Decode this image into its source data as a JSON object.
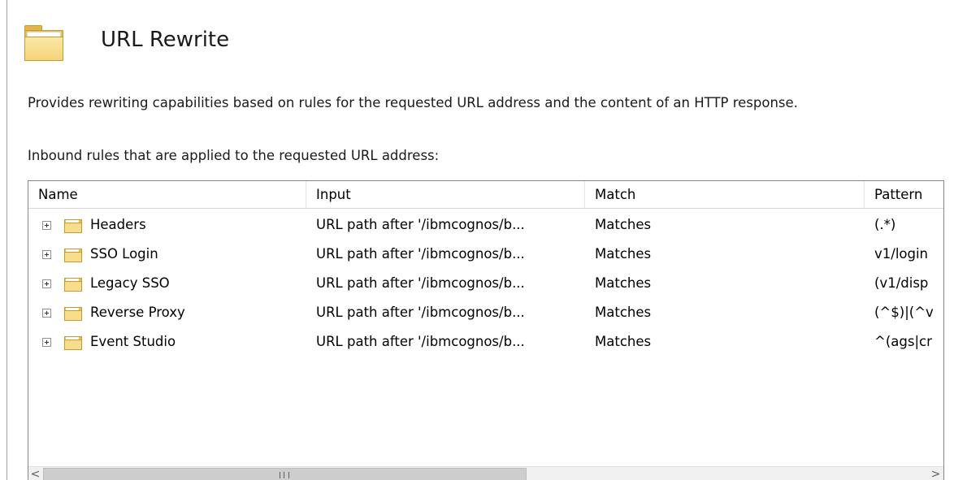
{
  "header": {
    "title": "URL Rewrite",
    "icon": "folder-icon"
  },
  "description": "Provides rewriting capabilities based on rules for the requested URL address and the content of an HTTP response.",
  "inbound": {
    "heading": "Inbound rules that are applied to the requested URL address:",
    "columns": [
      "Name",
      "Input",
      "Match",
      "Pattern"
    ],
    "rows": [
      {
        "name": "Headers",
        "input": "URL path after '/ibmcognos/b...",
        "match": "Matches",
        "pattern": "(.*)"
      },
      {
        "name": "SSO Login",
        "input": "URL path after '/ibmcognos/b...",
        "match": "Matches",
        "pattern": "v1/login"
      },
      {
        "name": "Legacy SSO",
        "input": "URL path after '/ibmcognos/b...",
        "match": "Matches",
        "pattern": "(v1/disp"
      },
      {
        "name": "Reverse Proxy",
        "input": "URL path after '/ibmcognos/b...",
        "match": "Matches",
        "pattern": "(^$)|(^v"
      },
      {
        "name": "Event Studio",
        "input": "URL path after '/ibmcognos/b...",
        "match": "Matches",
        "pattern": "^(ags|cr"
      }
    ],
    "scrollbar": {
      "left_arrow": "<",
      "right_arrow": ">"
    }
  },
  "colors": {
    "folder": "#e8be55",
    "border": "#828790"
  }
}
